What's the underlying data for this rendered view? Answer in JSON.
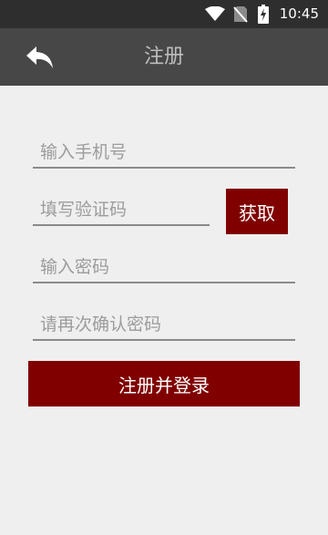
{
  "status_bar": {
    "time": "10:45",
    "icons": [
      "wifi-icon",
      "no-sim-icon",
      "battery-charging-icon"
    ]
  },
  "toolbar": {
    "back_icon": "reply-arrow-icon",
    "title": "注册"
  },
  "form": {
    "phone_placeholder": "输入手机号",
    "code_placeholder": "填写验证码",
    "get_code_label": "获取",
    "password_placeholder": "输入密码",
    "confirm_password_placeholder": "请再次确认密码",
    "submit_label": "注册并登录"
  },
  "colors": {
    "accent": "#800000",
    "toolbar_bg": "#474747",
    "statusbar_bg": "#2e2e2e",
    "page_bg": "#efefef"
  }
}
